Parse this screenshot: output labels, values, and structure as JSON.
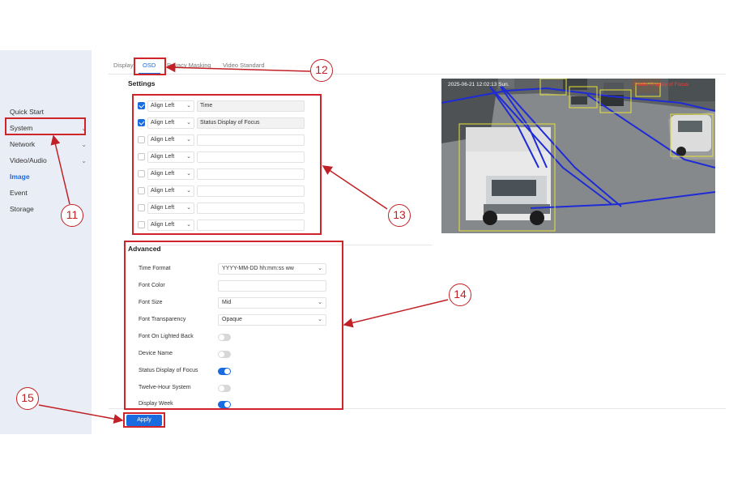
{
  "sidebar": {
    "items": [
      {
        "label": "Quick Start",
        "chevron": ""
      },
      {
        "label": "System",
        "chevron": "⌄"
      },
      {
        "label": "Network",
        "chevron": "⌄"
      },
      {
        "label": "Video/Audio",
        "chevron": "⌄"
      },
      {
        "label": "Image",
        "chevron": ""
      },
      {
        "label": "Event",
        "chevron": ""
      },
      {
        "label": "Storage",
        "chevron": ""
      }
    ],
    "active_index": 4
  },
  "tabs": [
    {
      "label": "Display"
    },
    {
      "label": "OSD"
    },
    {
      "label": "Privacy Masking"
    },
    {
      "label": "Video Standard"
    }
  ],
  "active_tab": "OSD",
  "settings": {
    "title": "Settings",
    "rows": [
      {
        "checked": true,
        "align": "Align Left",
        "text": "Time"
      },
      {
        "checked": true,
        "align": "Align Left",
        "text": "Status Display of Focus"
      },
      {
        "checked": false,
        "align": "Align Left",
        "text": ""
      },
      {
        "checked": false,
        "align": "Align Left",
        "text": ""
      },
      {
        "checked": false,
        "align": "Align Left",
        "text": ""
      },
      {
        "checked": false,
        "align": "Align Left",
        "text": ""
      },
      {
        "checked": false,
        "align": "Align Left",
        "text": ""
      },
      {
        "checked": false,
        "align": "Align Left",
        "text": ""
      }
    ]
  },
  "advanced": {
    "title": "Advanced",
    "time_format": {
      "label": "Time Format",
      "value": "YYYY-MM-DD hh:mm:ss ww"
    },
    "font_color": {
      "label": "Font Color"
    },
    "font_size": {
      "label": "Font Size",
      "value": "Mid"
    },
    "font_transparency": {
      "label": "Font Transparency",
      "value": "Opaque"
    },
    "toggles": [
      {
        "label": "Font On Lighted Back",
        "on": false
      },
      {
        "label": "Device Name",
        "on": false
      },
      {
        "label": "Status Display of Focus",
        "on": true
      },
      {
        "label": "Twelve-Hour System",
        "on": false
      },
      {
        "label": "Display Week",
        "on": true
      }
    ]
  },
  "apply_label": "Apply",
  "preview": {
    "timestamp": "2025-06-21 12:02:13 Sun.",
    "focus_status": "Status Display of Focus"
  },
  "annotations": [
    "11",
    "12",
    "13",
    "14",
    "15"
  ],
  "colors": {
    "accent": "#1a6be0",
    "annotation": "#d0232a",
    "sidebar_bg": "#e9edf5"
  }
}
